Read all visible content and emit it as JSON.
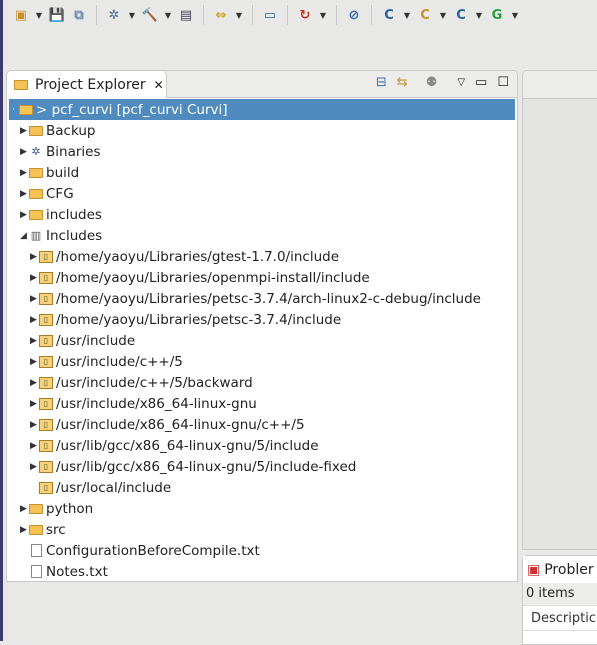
{
  "toolbar": {
    "icons": [
      "new-icon",
      "save-icon",
      "save-all-icon",
      "debug-icon",
      "build-icon",
      "binary-icon",
      "toggle-icon",
      "terminal-icon",
      "run-icon",
      "breakpoint-icon",
      "new-c-project-icon",
      "new-cpp-class-icon",
      "new-c-file-icon",
      "new-class-icon"
    ]
  },
  "explorer": {
    "title": "Project Explorer",
    "root": "> pcf_curvi [pcf_curvi Curvi]",
    "items": [
      {
        "label": "Backup",
        "type": "folder",
        "level": 1,
        "expandable": true
      },
      {
        "label": "Binaries",
        "type": "binaries",
        "level": 1,
        "expandable": true
      },
      {
        "label": "build",
        "type": "folder",
        "level": 1,
        "expandable": true
      },
      {
        "label": "CFG",
        "type": "folder",
        "level": 1,
        "expandable": true
      },
      {
        "label": "includes",
        "type": "folder",
        "level": 1,
        "expandable": true
      },
      {
        "label": "Includes",
        "type": "includes",
        "level": 1,
        "expandable": true,
        "expanded": true
      },
      {
        "label": "/home/yaoyu/Libraries/gtest-1.7.0/include",
        "type": "incfolder",
        "level": 2,
        "expandable": true
      },
      {
        "label": "/home/yaoyu/Libraries/openmpi-install/include",
        "type": "incfolder",
        "level": 2,
        "expandable": true
      },
      {
        "label": "/home/yaoyu/Libraries/petsc-3.7.4/arch-linux2-c-debug/include",
        "type": "incfolder",
        "level": 2,
        "expandable": true
      },
      {
        "label": "/home/yaoyu/Libraries/petsc-3.7.4/include",
        "type": "incfolder",
        "level": 2,
        "expandable": true
      },
      {
        "label": "/usr/include",
        "type": "incfolder",
        "level": 2,
        "expandable": true
      },
      {
        "label": "/usr/include/c++/5",
        "type": "incfolder",
        "level": 2,
        "expandable": true
      },
      {
        "label": "/usr/include/c++/5/backward",
        "type": "incfolder",
        "level": 2,
        "expandable": true
      },
      {
        "label": "/usr/include/x86_64-linux-gnu",
        "type": "incfolder",
        "level": 2,
        "expandable": true
      },
      {
        "label": "/usr/include/x86_64-linux-gnu/c++/5",
        "type": "incfolder",
        "level": 2,
        "expandable": true
      },
      {
        "label": "/usr/lib/gcc/x86_64-linux-gnu/5/include",
        "type": "incfolder",
        "level": 2,
        "expandable": true
      },
      {
        "label": "/usr/lib/gcc/x86_64-linux-gnu/5/include-fixed",
        "type": "incfolder",
        "level": 2,
        "expandable": true
      },
      {
        "label": "/usr/local/include",
        "type": "incfolder",
        "level": 2,
        "expandable": false
      },
      {
        "label": "python",
        "type": "folder",
        "level": 1,
        "expandable": true
      },
      {
        "label": "src",
        "type": "folder",
        "level": 1,
        "expandable": true
      },
      {
        "label": "ConfigurationBeforeCompile.txt",
        "type": "file",
        "level": 1,
        "expandable": false
      },
      {
        "label": "Notes.txt",
        "type": "file",
        "level": 1,
        "expandable": false
      }
    ]
  },
  "problems": {
    "title": "Probler",
    "count": "0 items",
    "column": "Descriptic"
  },
  "colors": {
    "selection": "#4f8bbf",
    "folder": "#f3c355"
  }
}
